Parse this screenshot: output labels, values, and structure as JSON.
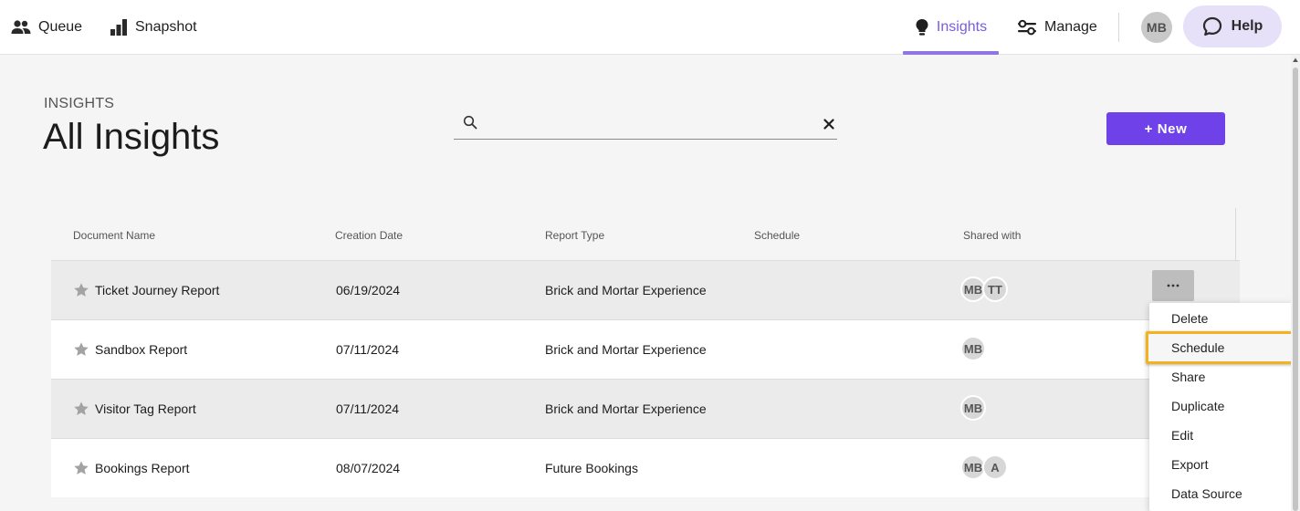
{
  "nav": {
    "queue": "Queue",
    "snapshot": "Snapshot",
    "insights": "Insights",
    "manage": "Manage",
    "user_initials": "MB",
    "help": "Help"
  },
  "header": {
    "section": "INSIGHTS",
    "title": "All Insights",
    "search_value": "",
    "search_placeholder": "",
    "new_button": "+ New"
  },
  "table": {
    "columns": [
      "Document Name",
      "Creation Date",
      "Report Type",
      "Schedule",
      "Shared with"
    ],
    "rows": [
      {
        "name": "Ticket Journey Report",
        "date": "06/19/2024",
        "type": "Brick and Mortar Experience",
        "schedule": "",
        "shared": [
          "MB",
          "TT"
        ]
      },
      {
        "name": "Sandbox Report",
        "date": "07/11/2024",
        "type": "Brick and Mortar Experience",
        "schedule": "",
        "shared": [
          "MB"
        ]
      },
      {
        "name": "Visitor Tag Report",
        "date": "07/11/2024",
        "type": "Brick and Mortar Experience",
        "schedule": "",
        "shared": [
          "MB"
        ]
      },
      {
        "name": "Bookings Report",
        "date": "08/07/2024",
        "type": "Future Bookings",
        "schedule": "",
        "shared": [
          "MB",
          "A"
        ]
      }
    ],
    "more_label": "..."
  },
  "menu": {
    "items": [
      "Delete",
      "Schedule",
      "Share",
      "Duplicate",
      "Edit",
      "Export",
      "Data Source"
    ],
    "highlighted": "Schedule"
  },
  "colors": {
    "accent": "#7a5cdc",
    "primary_button": "#6e42e8",
    "help_bg": "#e6e1f8",
    "highlight_border": "#f2b31e"
  },
  "icons": {
    "queue": "people-icon",
    "snapshot": "bar-chart-icon",
    "insights": "lightbulb-icon",
    "manage": "sliders-icon",
    "help": "chat-bubble-icon",
    "search": "search-icon",
    "clear": "close-icon",
    "favorite": "star-icon",
    "more": "more-horizontal-icon"
  }
}
